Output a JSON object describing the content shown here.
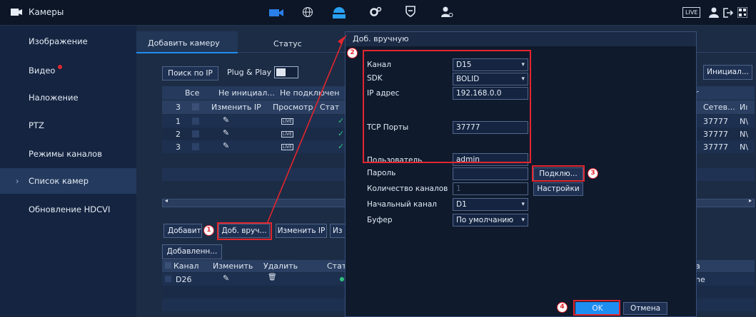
{
  "topbar": {
    "title": "Камеры",
    "live": "LIVE"
  },
  "sidebar": {
    "items": [
      {
        "label": "Изображение"
      },
      {
        "label": "Видео"
      },
      {
        "label": "Наложение"
      },
      {
        "label": "PTZ"
      },
      {
        "label": "Режимы каналов"
      },
      {
        "label": "Список камер"
      },
      {
        "label": "Обновление HDCVI"
      }
    ]
  },
  "main": {
    "tabs": [
      "Добавить камеру",
      "Статус"
    ],
    "search_button": "Поиск по IP",
    "plug_play": "Plug & Play",
    "init_button": "Инициал...",
    "filter_tabs": [
      "Все",
      "Не инициал...",
      "Не подключен"
    ],
    "table_headers": {
      "num": "3",
      "change_ip": "Изменить IP",
      "view": "Просмотр",
      "status": "Стат",
      "network": "Сетев...",
      "col_last": "Иı"
    },
    "rows": [
      {
        "n": "1",
        "port": "37777",
        "x": "N\\"
      },
      {
        "n": "2",
        "port": "37777",
        "x": "N\\"
      },
      {
        "n": "3",
        "port": "37777",
        "x": "N\\"
      }
    ],
    "actions": {
      "add": "Добавит",
      "manual": "Доб. вруч...",
      "change_ip": "Изменить IP",
      "iz": "Из"
    },
    "added_tab": "Добавленн...",
    "added_headers": {
      "channel": "Канал",
      "edit": "Изменить",
      "delete": "Удалить",
      "status": "Стат",
      "a": "а"
    },
    "added_rows": [
      {
        "channel": "D26",
        "tail": "ne"
      }
    ]
  },
  "dialog": {
    "title": "Доб. вручную",
    "fields": {
      "channel": {
        "label": "Канал",
        "value": "D15"
      },
      "sdk": {
        "label": "SDK",
        "value": "BOLID"
      },
      "ip": {
        "label": "IP адрес",
        "value": "192.168.0.0"
      },
      "tcp": {
        "label": "TCP Порты",
        "value": "37777"
      },
      "user": {
        "label": "Пользователь",
        "value": "admin"
      },
      "password": {
        "label": "Пароль",
        "value": ""
      },
      "count": {
        "label": "Количество каналов",
        "value": "1"
      },
      "start": {
        "label": "Начальный канал",
        "value": "D1"
      },
      "buffer": {
        "label": "Буфер",
        "value": "По умолчанию"
      }
    },
    "connect_button": "Подклю...",
    "settings_button": "Настройки",
    "ok": "OK",
    "cancel": "Отмена"
  },
  "badges": [
    "1",
    "2",
    "3",
    "4"
  ],
  "colors": {
    "accent": "#1f8ef1",
    "highlight": "#e2262e"
  }
}
